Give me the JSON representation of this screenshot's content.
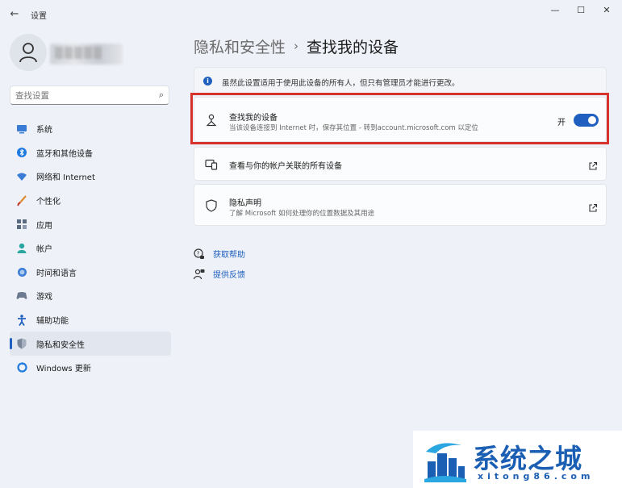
{
  "window": {
    "title": "设置",
    "back_icon": "back-arrow-icon",
    "controls": {
      "minimize": "—",
      "maximize": "☐",
      "close": "✕"
    }
  },
  "profile": {
    "name": "▒▒▒▒▒"
  },
  "search": {
    "placeholder": "查找设置",
    "value": ""
  },
  "sidebar": {
    "items": [
      {
        "label": "系统",
        "icon": "system-icon",
        "color": "#3a7bd5",
        "active": false
      },
      {
        "label": "蓝牙和其他设备",
        "icon": "bluetooth-icon",
        "color": "#1f7ae0",
        "active": false
      },
      {
        "label": "网络和 Internet",
        "icon": "wifi-icon",
        "color": "#3a7bd5",
        "active": false
      },
      {
        "label": "个性化",
        "icon": "brush-icon",
        "color": "#e08a2e",
        "active": false
      },
      {
        "label": "应用",
        "icon": "apps-icon",
        "color": "#5a6b80",
        "active": false
      },
      {
        "label": "帐户",
        "icon": "account-icon",
        "color": "#2aa6a0",
        "active": false
      },
      {
        "label": "时间和语言",
        "icon": "globe-clock-icon",
        "color": "#3a7bd5",
        "active": false
      },
      {
        "label": "游戏",
        "icon": "gamepad-icon",
        "color": "#6b7a90",
        "active": false
      },
      {
        "label": "辅助功能",
        "icon": "accessibility-icon",
        "color": "#1f5fbf",
        "active": false
      },
      {
        "label": "隐私和安全性",
        "icon": "shield-icon",
        "color": "#7a869a",
        "active": true
      },
      {
        "label": "Windows 更新",
        "icon": "update-icon",
        "color": "#1f7ae0",
        "active": false
      }
    ]
  },
  "breadcrumb": {
    "parent": "隐私和安全性",
    "separator": "›",
    "current": "查找我的设备"
  },
  "info_bar": {
    "text": "虽然此设置适用于使用此设备的所有人，但只有管理员才能进行更改。"
  },
  "find_device": {
    "title": "查找我的设备",
    "subtitle": "当该设备连接到 Internet 时，保存其位置 - 转到account.microsoft.com 以定位",
    "toggle_label": "开",
    "toggle_on": true
  },
  "devices_link": {
    "title": "查看与你的帐户关联的所有设备"
  },
  "privacy": {
    "title": "隐私声明",
    "subtitle": "了解 Microsoft 如何处理你的位置数据及其用途"
  },
  "links": [
    {
      "label": "获取帮助",
      "icon": "help-icon"
    },
    {
      "label": "提供反馈",
      "icon": "feedback-icon"
    }
  ],
  "watermark": {
    "title": "系统之城",
    "url": "xitong86.com"
  },
  "colors": {
    "accent": "#1f5fbf",
    "highlight": "#d8322f",
    "background": "#eef2f8"
  }
}
